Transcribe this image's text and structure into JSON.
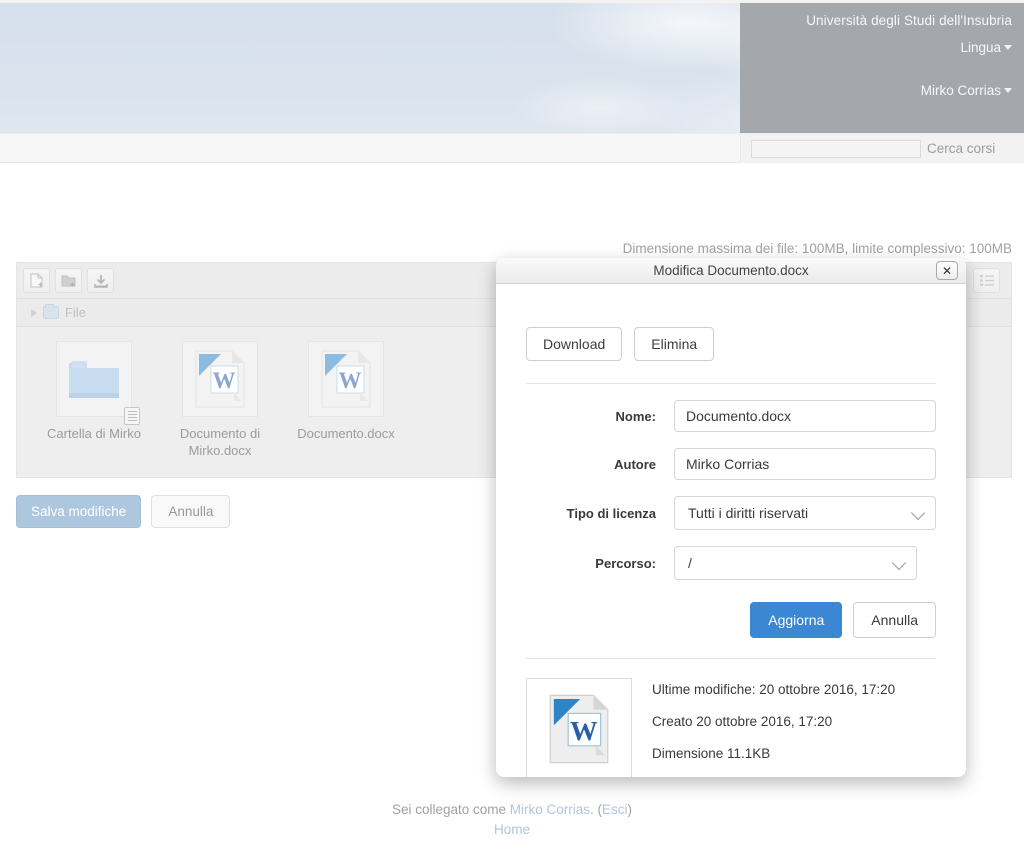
{
  "header": {
    "university": "Università degli Studi dell'Insubria",
    "language_menu": "Lingua",
    "user_menu": "Mirko Corrias"
  },
  "search": {
    "value": "",
    "placeholder": "",
    "button_label": "Cerca corsi"
  },
  "content": {
    "max_size_note": "Dimensione massima dei file: 100MB, limite complessivo: 100MB"
  },
  "filemanager": {
    "toolbar": {
      "new_file_label": "Crea file",
      "new_folder_label": "Crea cartella",
      "download_label": "Scarica tutto",
      "view_list_label": "Visualizza elenco"
    },
    "breadcrumb": "File",
    "items": [
      {
        "name": "Cartella di Mirko",
        "type": "folder"
      },
      {
        "name": "Documento di Mirko.docx",
        "type": "word"
      },
      {
        "name": "Documento.docx",
        "type": "word"
      }
    ]
  },
  "form_actions": {
    "save_label": "Salva modifiche",
    "cancel_label": "Annulla"
  },
  "footer": {
    "logged_prefix": "Sei collegato come ",
    "user_name": "Mirko Corrias",
    "logged_mid": ". (",
    "logout_label": "Esci",
    "logged_suffix": ")",
    "home_label": "Home"
  },
  "modal": {
    "title": "Modifica Documento.docx",
    "close_label": "✕",
    "download_label": "Download",
    "delete_label": "Elimina",
    "fields": {
      "name_label": "Nome:",
      "name_value": "Documento.docx",
      "author_label": "Autore",
      "author_value": "Mirko Corrias",
      "license_label": "Tipo di licenza",
      "license_value": "Tutti i diritti riservati",
      "path_label": "Percorso:",
      "path_value": "/"
    },
    "update_label": "Aggiorna",
    "cancel_label": "Annulla",
    "meta": {
      "modified": "Ultime modifiche: 20 ottobre 2016, 17:20",
      "created": "Creato 20 ottobre 2016, 17:20",
      "size": "Dimensione 11.1KB"
    }
  },
  "colors": {
    "accent_blue": "#3b87d4",
    "header_dark": "#5a5f66",
    "save_blue": "#6b9ac4",
    "link_blue": "#6b96c4"
  }
}
